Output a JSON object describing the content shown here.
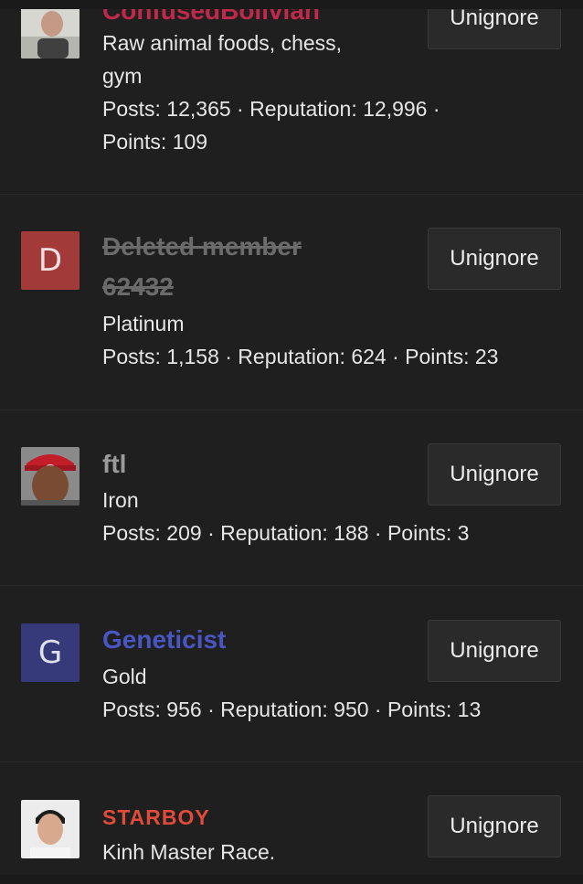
{
  "members": [
    {
      "name": "ConfusedBolivian",
      "bio_line1": "Raw animal foods, chess,",
      "bio_line2": "gym",
      "stats_line1": "Posts: 12,365 · Reputation: 12,996 ·",
      "stats_line2": "Points: 109",
      "button": "Unignore"
    },
    {
      "name": "Deleted member 62432",
      "avatar_letter": "D",
      "avatar_color": "#a33a3a",
      "title": "Platinum",
      "stats": "Posts: 1,158 · Reputation: 624 · Points: 23",
      "button": "Unignore"
    },
    {
      "name": "ftl",
      "title": "Iron",
      "stats": "Posts: 209 · Reputation: 188 · Points: 3",
      "button": "Unignore"
    },
    {
      "name": "Geneticist",
      "avatar_letter": "G",
      "avatar_color": "#363a7a",
      "title": "Gold",
      "stats": "Posts: 956 · Reputation: 950 · Points: 13",
      "button": "Unignore"
    },
    {
      "name": "STARBOY",
      "title": "Kinh Master Race.",
      "button": "Unignore"
    }
  ]
}
